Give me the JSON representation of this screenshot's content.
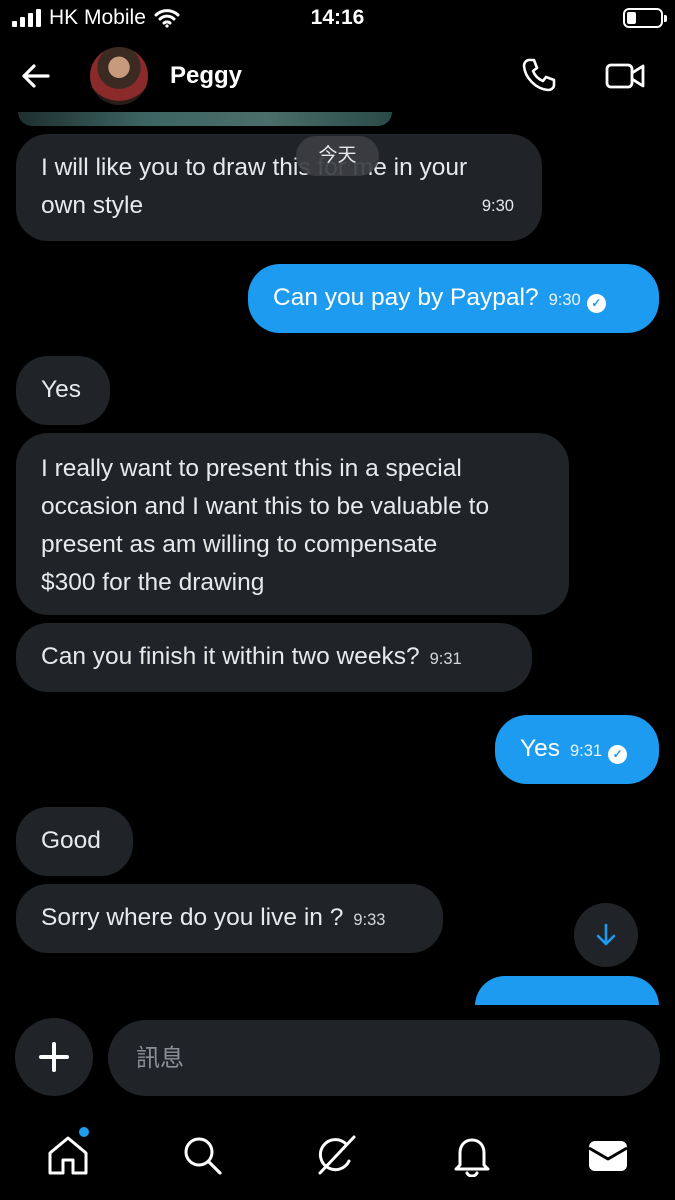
{
  "status_bar": {
    "carrier": "HK Mobile",
    "time": "14:16"
  },
  "header": {
    "contact_name": "Peggy"
  },
  "chat": {
    "day_separator": "今天",
    "messages": [
      {
        "dir": "in",
        "text_lines": [
          "I will like you to draw this for me in your",
          "own style"
        ],
        "time": "9:30"
      },
      {
        "dir": "out",
        "text": "Can you pay by Paypal?",
        "time": "9:30"
      },
      {
        "dir": "in",
        "text": "Yes"
      },
      {
        "dir": "in",
        "text_lines": [
          "I really want to present this in a special",
          "occasion and I want this to be valuable to",
          "present  as am willing to  compensate",
          "$300 for the drawing"
        ]
      },
      {
        "dir": "in",
        "text": "Can you finish it within two weeks?",
        "time": "9:31"
      },
      {
        "dir": "out",
        "text": "Yes",
        "time": "9:31"
      },
      {
        "dir": "in",
        "text": "Good"
      },
      {
        "dir": "in",
        "text": "Sorry where do you live in ?",
        "time": "9:33"
      }
    ]
  },
  "composer": {
    "placeholder": "訊息"
  },
  "icons": {
    "back": "arrow-left-icon",
    "call": "phone-icon",
    "video": "video-camera-icon",
    "add": "plus-icon",
    "scroll": "arrow-down-icon",
    "read": "check-circle-icon",
    "nav": [
      "home-icon",
      "search-icon",
      "grok-icon",
      "bell-icon",
      "mail-icon"
    ]
  },
  "colors": {
    "accent": "#1d9bf0",
    "incoming_bubble": "#202327",
    "background": "#000000"
  }
}
